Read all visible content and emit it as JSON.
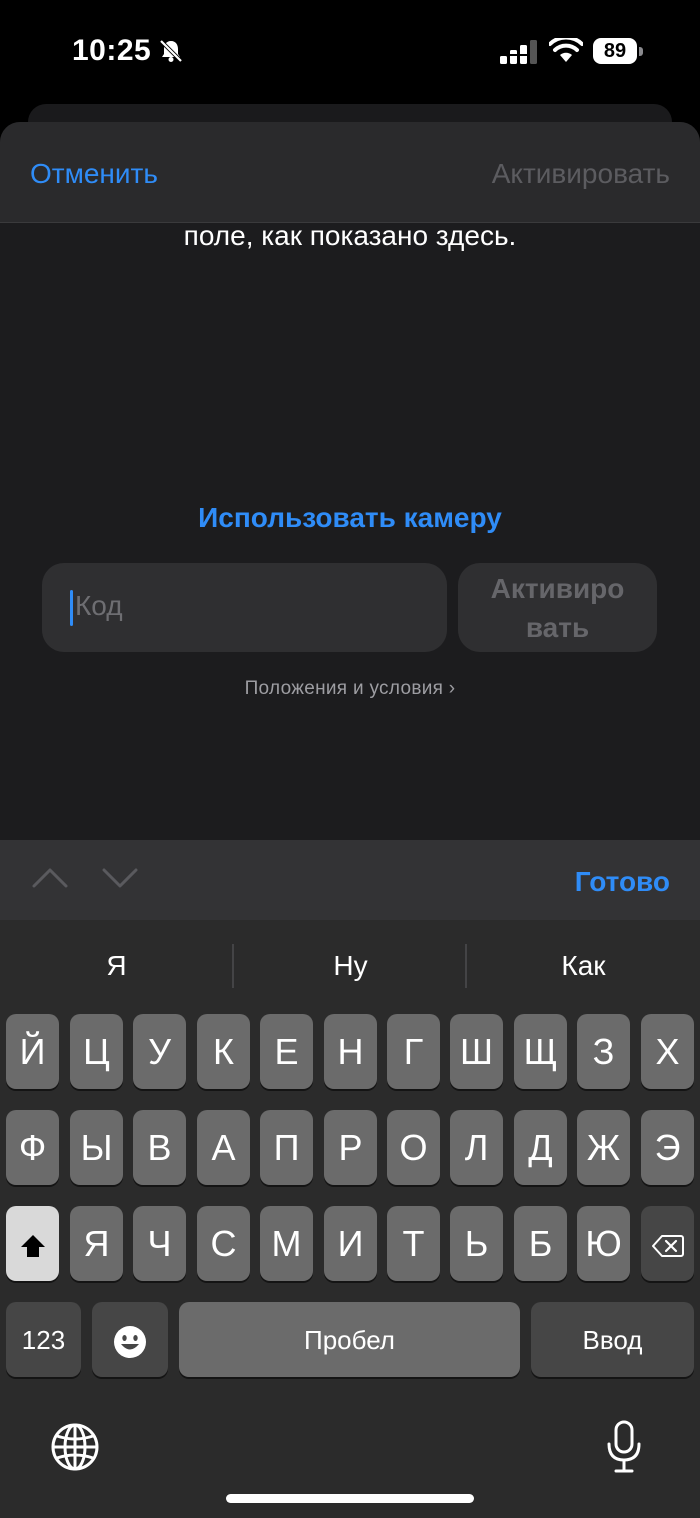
{
  "status_bar": {
    "time": "10:25",
    "battery": "89"
  },
  "nav": {
    "cancel_label": "Отменить",
    "activate_label": "Активировать"
  },
  "content": {
    "instruction_text": "поле, как показано здесь.",
    "use_camera_label": "Использовать камеру",
    "code_placeholder": "Код",
    "activate_button_label": "Активировать",
    "terms_label": "Положения и условия ›"
  },
  "keyboard": {
    "done_label": "Готово",
    "suggestions": [
      "Я",
      "Ну",
      "Как"
    ],
    "row1": [
      "Й",
      "Ц",
      "У",
      "К",
      "Е",
      "Н",
      "Г",
      "Ш",
      "Щ",
      "З",
      "Х"
    ],
    "row2": [
      "Ф",
      "Ы",
      "В",
      "А",
      "П",
      "Р",
      "О",
      "Л",
      "Д",
      "Ж",
      "Э"
    ],
    "row3": [
      "Я",
      "Ч",
      "С",
      "М",
      "И",
      "Т",
      "Ь",
      "Б",
      "Ю"
    ],
    "numbers_label": "123",
    "space_label": "Пробел",
    "return_label": "Ввод"
  },
  "colors": {
    "accent": "#2f8cf7",
    "sheet": "#1c1c1e",
    "keyboard": "#2b2b2b",
    "key": "#6b6b6b"
  }
}
